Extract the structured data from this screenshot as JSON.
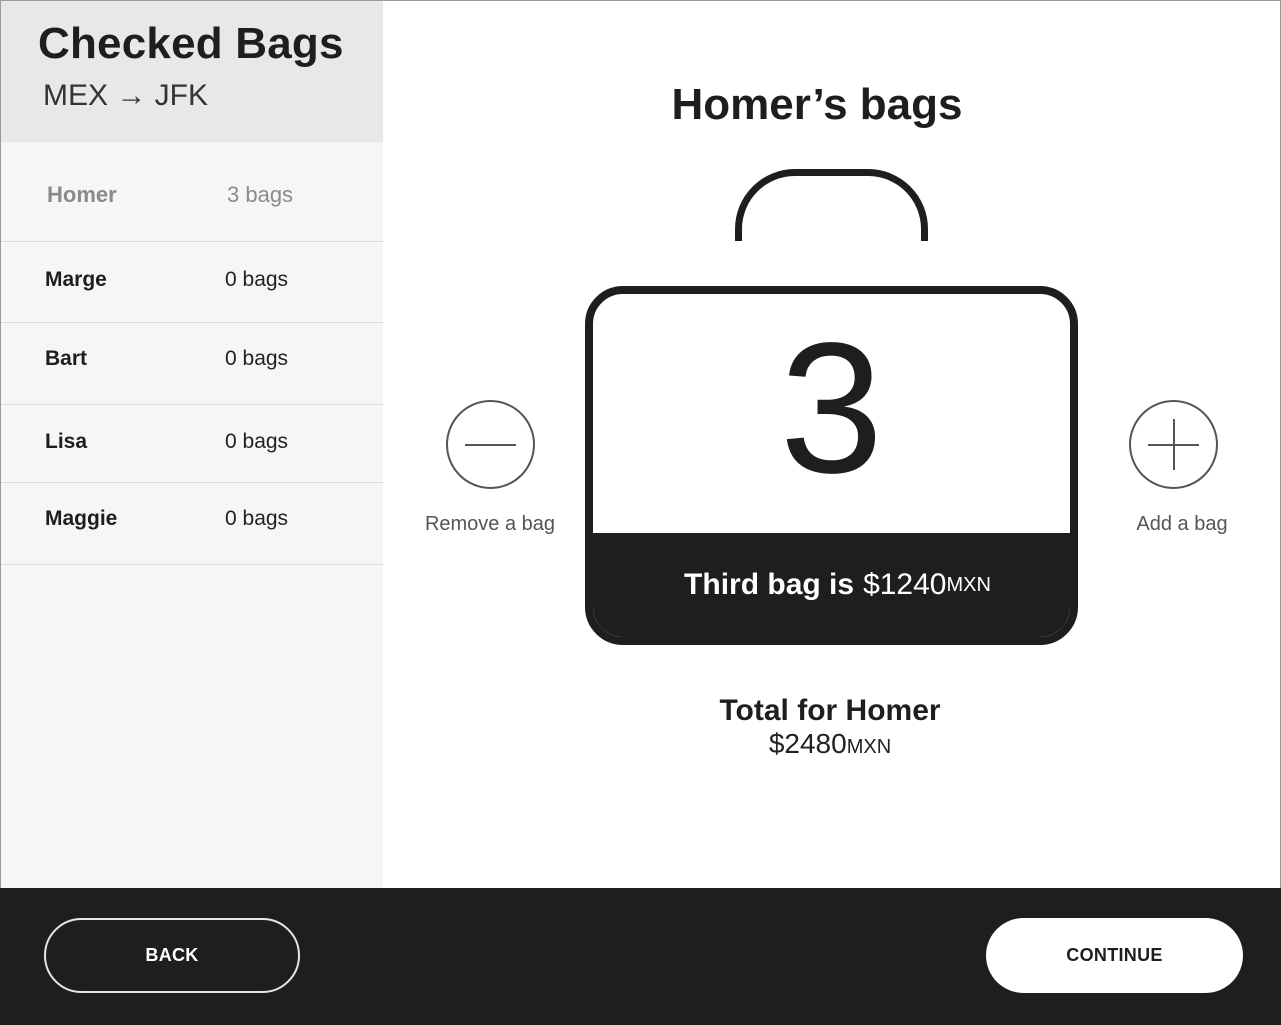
{
  "sidebar": {
    "title": "Checked Bags",
    "route": "MEX → JFK",
    "passengers": [
      {
        "name": "Homer",
        "bags": "3 bags",
        "active": true
      },
      {
        "name": "Marge",
        "bags": "0 bags",
        "active": false
      },
      {
        "name": "Bart",
        "bags": "0 bags",
        "active": false
      },
      {
        "name": "Lisa",
        "bags": "0 bags",
        "active": false
      },
      {
        "name": "Maggie",
        "bags": "0 bags",
        "active": false
      }
    ]
  },
  "main": {
    "title": "Homer’s bags",
    "bag_count": "3",
    "bag_label": "Third bag is",
    "bag_price": "$1240",
    "bag_currency": "MXN",
    "remove_label": "Remove a bag",
    "add_label": "Add a bag",
    "total_label": "Total for Homer",
    "total_amount": "$2480",
    "total_currency": "MXN"
  },
  "footer": {
    "back_label": "BACK",
    "continue_label": "CONTINUE"
  },
  "colors": {
    "dark": "#1e1e1e",
    "sidebar_bg": "#f6f6f6",
    "sidebar_header_bg": "#e8e8e8",
    "muted_text": "#8a8a8a"
  },
  "icons": {
    "remove": "minus-icon",
    "add": "plus-icon",
    "bag": "suitcase-icon"
  }
}
